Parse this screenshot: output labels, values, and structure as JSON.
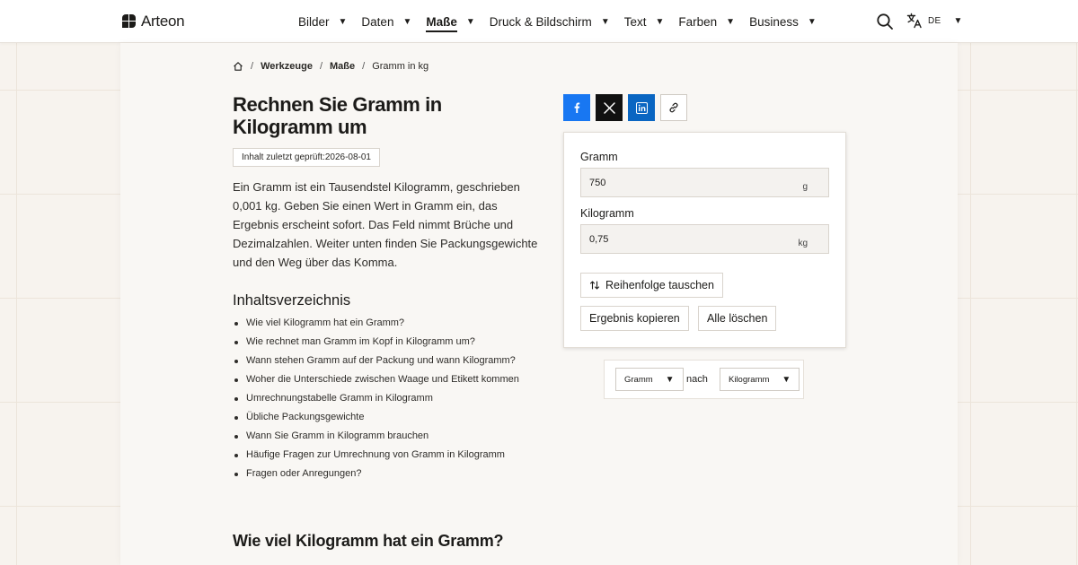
{
  "brand": {
    "name": "Arteon"
  },
  "nav": {
    "items": [
      {
        "label": "Bilder",
        "active": false
      },
      {
        "label": "Daten",
        "active": false
      },
      {
        "label": "Maße",
        "active": true
      },
      {
        "label": "Druck & Bildschirm",
        "active": false
      },
      {
        "label": "Text",
        "active": false
      },
      {
        "label": "Farben",
        "active": false
      },
      {
        "label": "Business",
        "active": false
      }
    ],
    "caret": "▼",
    "language": "DE"
  },
  "breadcrumb": {
    "items": [
      "Werkzeuge",
      "Maße",
      "Gramm in kg"
    ],
    "separator": "/"
  },
  "page": {
    "title": "Rechnen Sie Gramm in Kilogramm um",
    "checked": "Inhalt zuletzt geprüft:2026-08-01",
    "intro": "Ein Gramm ist ein Tausendstel Kilogramm, geschrieben 0,001 kg. Geben Sie einen Wert in Gramm ein, das Ergebnis erscheint sofort. Das Feld nimmt Brüche und Dezimalzahlen. Weiter unten finden Sie Packungsgewichte und den Weg über das Komma.",
    "toc_title": "Inhaltsverzeichnis",
    "toc": [
      "Wie viel Kilogramm hat ein Gramm?",
      "Wie rechnet man Gramm im Kopf in Kilogramm um?",
      "Wann stehen Gramm auf der Packung und wann Kilogramm?",
      "Woher die Unterschiede zwischen Waage und Etikett kommen",
      "Umrechnungstabelle Gramm in Kilogramm",
      "Übliche Packungsgewichte",
      "Wann Sie Gramm in Kilogramm brauchen",
      "Häufige Fragen zur Umrechnung von Gramm in Kilogramm",
      "Fragen oder Anregungen?"
    ],
    "section_title": "Wie viel Kilogramm hat ein Gramm?"
  },
  "share": {
    "icons": [
      "facebook-icon",
      "x-icon",
      "linkedin-icon",
      "link-icon"
    ]
  },
  "converter": {
    "from_label": "Gramm",
    "from_value": "750",
    "from_unit": "g",
    "to_label": "Kilogramm",
    "to_value": "0,75",
    "to_unit": "kg",
    "swap_label": "Reihenfolge tauschen",
    "copy_label": "Ergebnis kopieren",
    "clear_label": "Alle löschen"
  },
  "unit_select": {
    "from": "Gramm",
    "connector": "nach",
    "to": "Kilogramm"
  },
  "colors": {
    "facebook": "#1877f2",
    "x": "#111111",
    "linkedin": "#0a66c2",
    "background": "#f7f3ee"
  }
}
